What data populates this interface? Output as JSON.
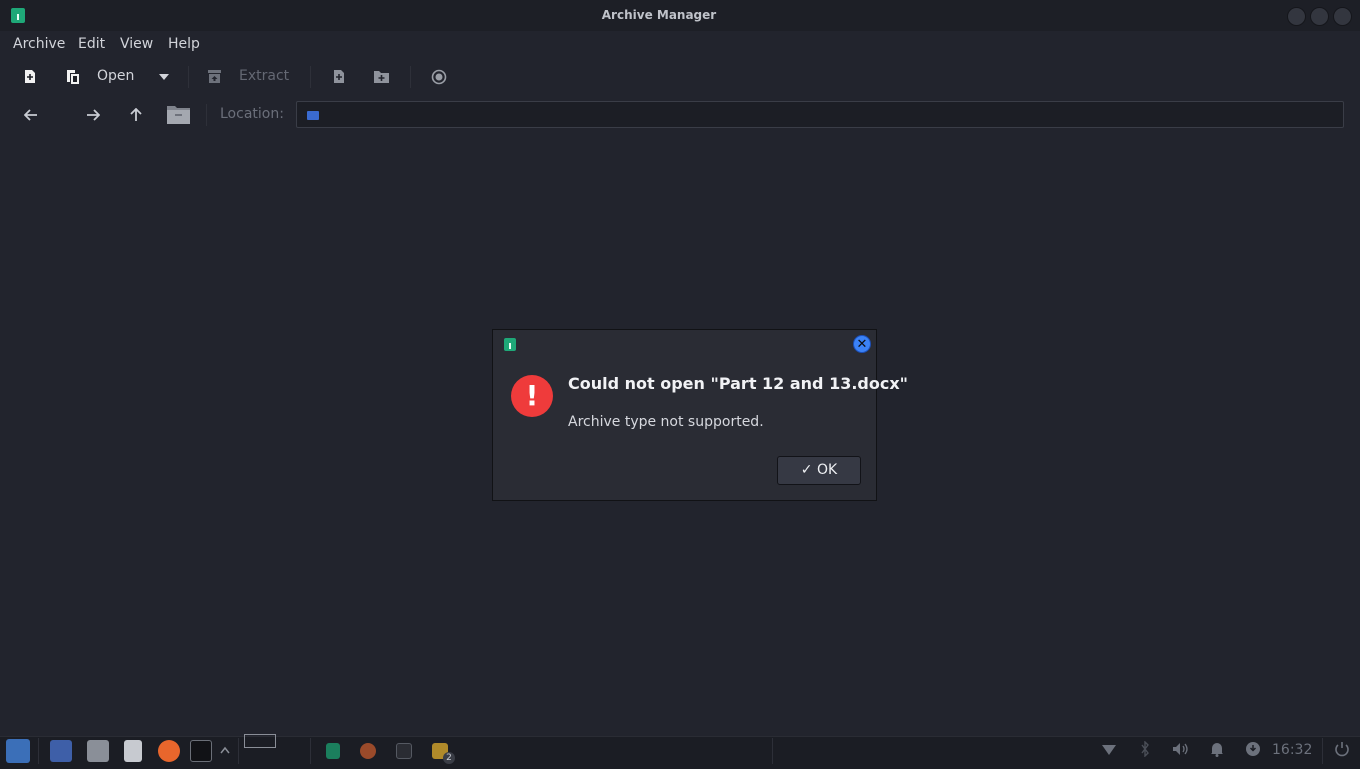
{
  "window": {
    "title": "Archive Manager"
  },
  "menu": [
    "Archive",
    "Edit",
    "View",
    "Help"
  ],
  "toolbar": {
    "open_label": "Open",
    "extract_label": "Extract"
  },
  "location": {
    "label": "Location:",
    "value": ""
  },
  "dialog": {
    "heading": "Could not open \"Part 12 and 13.docx\"",
    "message": "Archive type not supported.",
    "ok_label": "OK",
    "close_glyph": "✕",
    "alert_glyph": "!",
    "check_glyph": "✓"
  },
  "taskbar": {
    "clock": "16:32",
    "badge": "2"
  },
  "icons": {
    "app": "archive-icon",
    "new": "new-archive-icon",
    "open": "open-archive-icon",
    "extract": "extract-icon",
    "add_file": "add-file-icon",
    "add_folder": "add-folder-icon",
    "stop": "stop-icon",
    "back": "arrow-left-icon",
    "forward": "arrow-right-icon",
    "up": "arrow-up-icon",
    "home": "folder-home-icon"
  },
  "colors": {
    "background": "#22242d",
    "accent": "#3b82f6",
    "error": "#ef3b3b",
    "app_icon": "#1fa878"
  }
}
